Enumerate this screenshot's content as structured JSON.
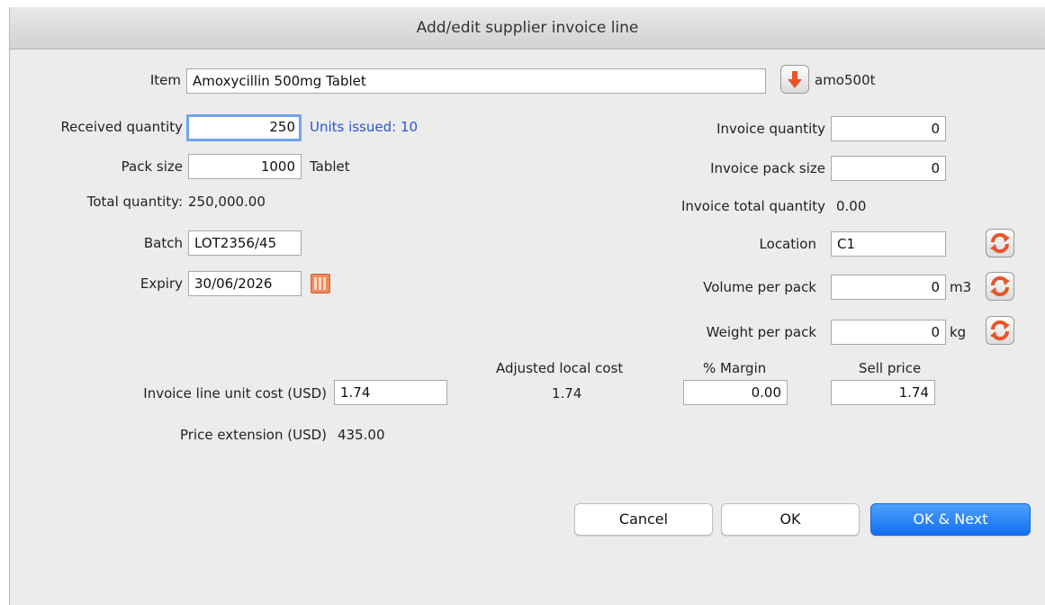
{
  "window": {
    "title": "Add/edit supplier invoice line"
  },
  "item": {
    "label": "Item",
    "value": "Amoxycillin 500mg Tablet",
    "code": "amo500t",
    "dropdown_icon": "arrow-down-icon"
  },
  "left": {
    "received_quantity": {
      "label": "Received quantity",
      "value": "250",
      "units_issued": "Units issued: 10"
    },
    "pack_size": {
      "label": "Pack size",
      "value": "1000",
      "unit": "Tablet"
    },
    "total_quantity": {
      "label": "Total quantity:",
      "value": "250,000.00"
    },
    "batch": {
      "label": "Batch",
      "value": "LOT2356/45"
    },
    "expiry": {
      "label": "Expiry",
      "value": "30/06/2026",
      "icon": "calendar-icon"
    }
  },
  "right": {
    "invoice_quantity": {
      "label": "Invoice quantity",
      "value": "0"
    },
    "invoice_pack_size": {
      "label": "Invoice pack size",
      "value": "0"
    },
    "invoice_total_quantity": {
      "label": "Invoice total quantity",
      "value": "0.00"
    },
    "location": {
      "label": "Location",
      "value": "C1"
    },
    "volume_per_pack": {
      "label": "Volume per pack",
      "value": "0",
      "unit": "m3"
    },
    "weight_per_pack": {
      "label": "Weight per pack",
      "value": "0",
      "unit": "kg"
    },
    "refresh_icon": "refresh-icon"
  },
  "pricing": {
    "unit_cost": {
      "label": "Invoice line unit cost (USD)",
      "value": "1.74"
    },
    "adjusted_local_cost": {
      "label": "Adjusted local cost",
      "value": "1.74"
    },
    "margin": {
      "label": "% Margin",
      "value": "0.00"
    },
    "sell_price": {
      "label": "Sell price",
      "value": "1.74"
    },
    "price_extension": {
      "label": "Price extension (USD)",
      "value": "435.00"
    }
  },
  "buttons": {
    "cancel": "Cancel",
    "ok": "OK",
    "ok_next": "OK & Next"
  },
  "colors": {
    "accent": "#1270f0",
    "link": "#2a55d6",
    "icon_orange": "#e8552a"
  }
}
